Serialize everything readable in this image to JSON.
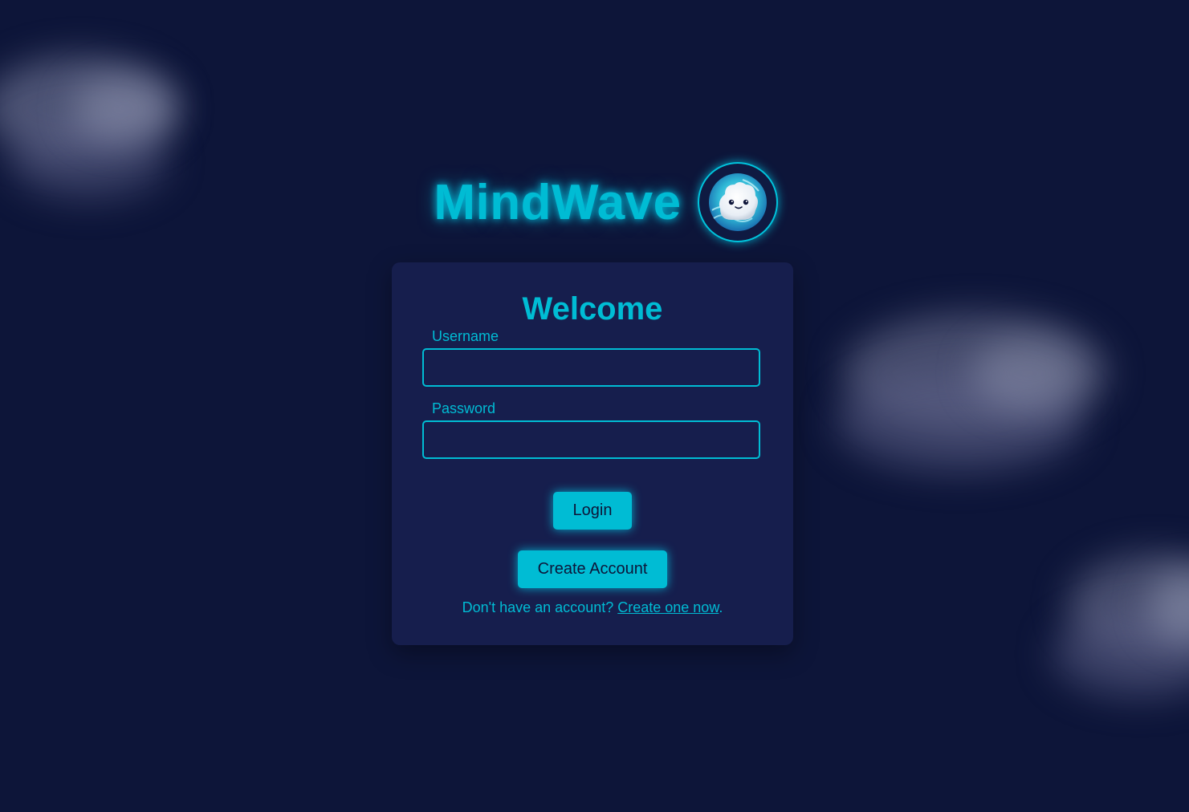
{
  "brand": {
    "title": "MindWave",
    "logo_icon": "cute-cloud-mascot-icon"
  },
  "login_card": {
    "heading": "Welcome",
    "username": {
      "label": "Username",
      "value": "",
      "placeholder": ""
    },
    "password": {
      "label": "Password",
      "value": "",
      "placeholder": ""
    },
    "login_label": "Login",
    "create_account_label": "Create Account",
    "signup_prompt": "Don't have an account? ",
    "signup_link": "Create one now",
    "signup_suffix": "."
  },
  "colors": {
    "background": "#0d1539",
    "card": "#161e4d",
    "accent": "#00bcd4"
  }
}
